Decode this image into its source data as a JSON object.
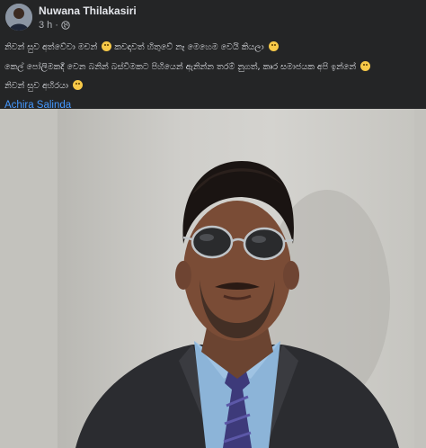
{
  "post": {
    "author": "Nuwana Thilakasiri",
    "time": "3 h",
    "separator": "·",
    "privacy_icon": "globe-icon",
    "caption_lines": [
      "නිවන් සුව අත්වේවා මචන්",
      "කෙල් පෝලිමකදී වෙන බනින් බස්වීමකට පිහියෙන් ඇනින්න තරම් නුගත්, කෘර සමාජයක අපි ඉන්නේ",
      "නිවන් සුව අහිරයා"
    ],
    "caption_line1_suffix": "කවදාවත් හිතුවේ නෑ මෙහෙම වෙයි කියලා",
    "tagged_person": "Achira Salinda"
  },
  "colors": {
    "background": "#242526",
    "text": "#e4e6eb",
    "muted": "#b0b3b8",
    "link": "#4599ff"
  }
}
